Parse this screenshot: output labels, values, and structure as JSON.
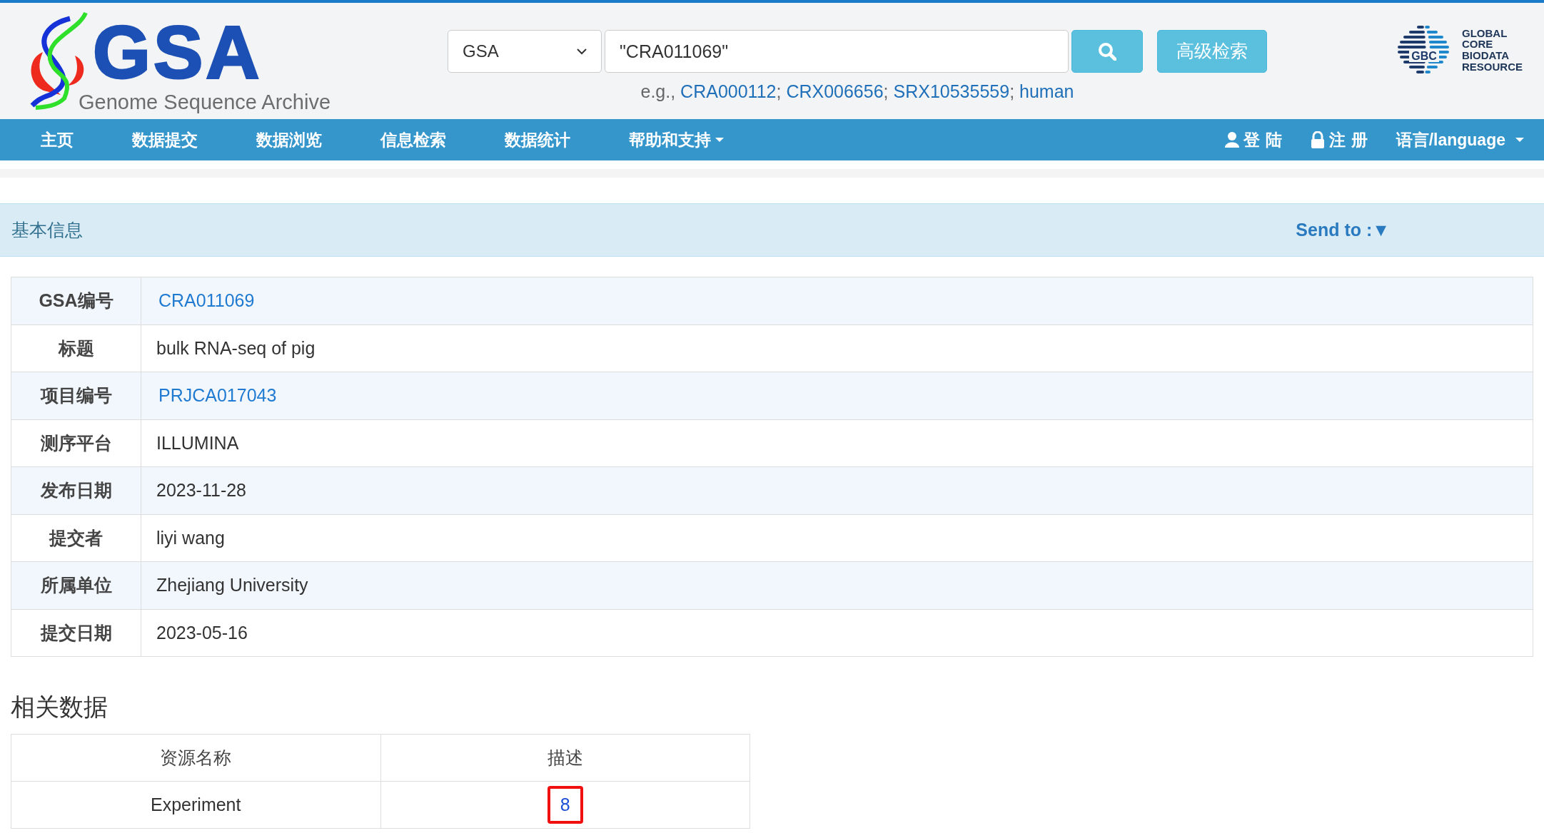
{
  "header": {
    "logo": {
      "title": "GSA",
      "subtitle": "Genome Sequence Archive"
    },
    "search": {
      "database": "GSA",
      "value": "\"CRA011069\"",
      "advanced_button": "高级检索",
      "examples_prefix": "e.g.,",
      "separator": ";",
      "examples": [
        "CRA000112",
        "CRX006656",
        "SRX10535559",
        "human"
      ]
    },
    "partner_logo": {
      "mark": "GBC",
      "lines": [
        "GLOBAL",
        "CORE",
        "BIODATA",
        "RESOURCE"
      ]
    }
  },
  "nav": {
    "items": [
      {
        "label": "主页",
        "dropdown": false
      },
      {
        "label": "数据提交",
        "dropdown": false
      },
      {
        "label": "数据浏览",
        "dropdown": false
      },
      {
        "label": "信息检索",
        "dropdown": false
      },
      {
        "label": "数据统计",
        "dropdown": false
      },
      {
        "label": "帮助和支持",
        "dropdown": true
      }
    ],
    "right": [
      {
        "label": "登 陆",
        "kind": "user",
        "dropdown": false
      },
      {
        "label": "注 册",
        "kind": "lock",
        "dropdown": false
      },
      {
        "label": "语言/language",
        "kind": "plain",
        "dropdown": true
      }
    ]
  },
  "section": {
    "title": "基本信息",
    "send_to": "Send to :▼"
  },
  "info_rows": [
    {
      "label": "GSA编号",
      "value": "CRA011069",
      "link": true
    },
    {
      "label": "标题",
      "value": "bulk RNA-seq of pig",
      "link": false
    },
    {
      "label": "项目编号",
      "value": "PRJCA017043",
      "link": true
    },
    {
      "label": "测序平台",
      "value": "ILLUMINA",
      "link": false
    },
    {
      "label": "发布日期",
      "value": "2023-11-28",
      "link": false
    },
    {
      "label": "提交者",
      "value": "liyi wang",
      "link": false
    },
    {
      "label": "所属单位",
      "value": "Zhejiang University",
      "link": false
    },
    {
      "label": "提交日期",
      "value": "2023-05-16",
      "link": false
    }
  ],
  "related": {
    "title": "相关数据",
    "columns": [
      "资源名称",
      "描述"
    ],
    "rows": [
      {
        "name": "Experiment",
        "count": "8",
        "highlighted": true
      }
    ]
  }
}
